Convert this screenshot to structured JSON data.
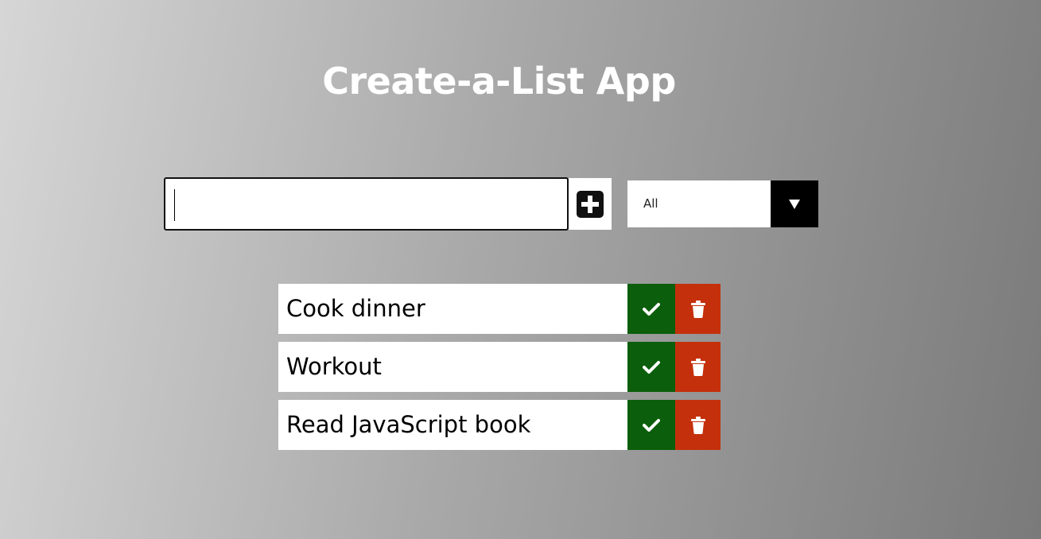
{
  "app": {
    "title": "Create-a-List App"
  },
  "form": {
    "input_value": "",
    "add_icon": "plus-square-icon",
    "filter_selected": "All"
  },
  "todos": [
    {
      "text": "Cook dinner"
    },
    {
      "text": "Workout"
    },
    {
      "text": "Read JavaScript book"
    }
  ],
  "colors": {
    "complete": "#0b5e0b",
    "trash": "#c4300b",
    "filter_arrow_bg": "#000000"
  },
  "icons": {
    "complete": "check-icon",
    "trash": "trash-icon",
    "filter_arrow": "caret-down-icon"
  }
}
